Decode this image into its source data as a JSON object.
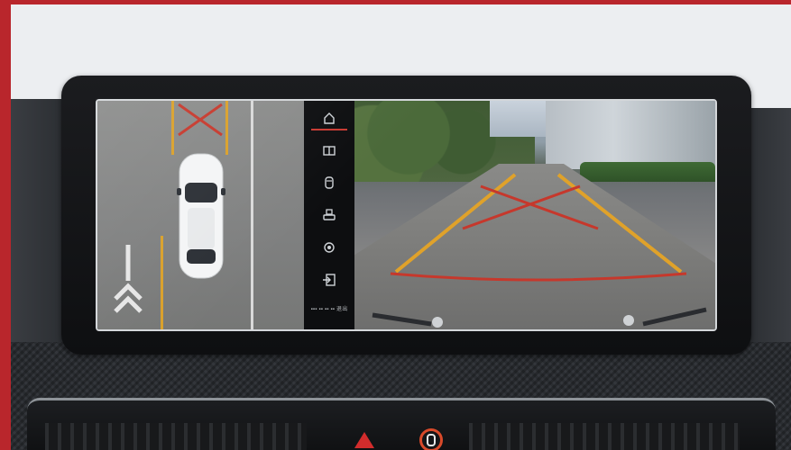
{
  "colors": {
    "frame_accent": "#b9262c",
    "active_indicator": "#c83a32",
    "guide_yellow": "#e0a22a",
    "guide_red": "#c6382c",
    "hazard": "#d22c2c"
  },
  "camera_menu": {
    "items": [
      {
        "icon": "home-view-icon"
      },
      {
        "icon": "split-view-icon"
      },
      {
        "icon": "front-camera-icon"
      },
      {
        "icon": "rear-car-icon"
      },
      {
        "icon": "settings-gear-icon"
      },
      {
        "icon": "exit-icon"
      }
    ],
    "active_index": 0,
    "caption": "▪▪▪ ▪▪ ▪▪ ▪▪ 退出"
  }
}
